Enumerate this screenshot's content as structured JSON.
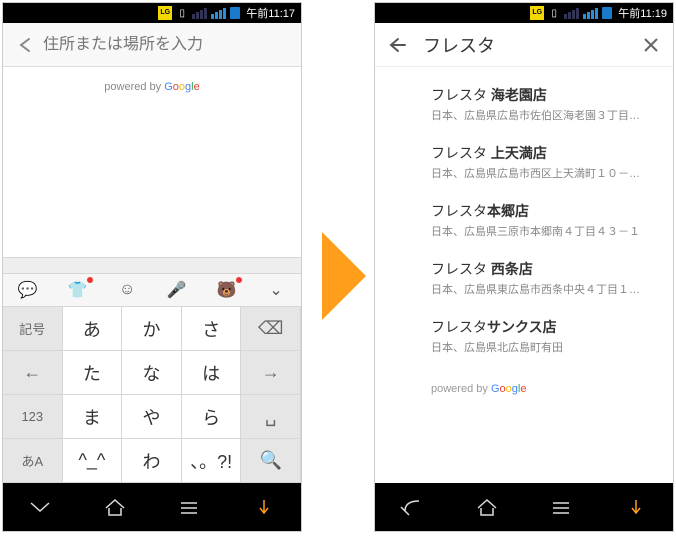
{
  "left": {
    "status_time": "午前11:17",
    "search_placeholder": "住所または場所を入力",
    "powered_prefix": "powered by ",
    "kbd_toolbar": [
      "speech",
      "shirt",
      "emoji",
      "mic",
      "bear",
      "chev"
    ],
    "keys": [
      {
        "t": "記号",
        "cls": "shade"
      },
      {
        "t": "あ"
      },
      {
        "t": "か"
      },
      {
        "t": "さ"
      },
      {
        "t": "⌫",
        "cls": "shade big"
      },
      {
        "t": "←",
        "cls": "shade big"
      },
      {
        "t": "た"
      },
      {
        "t": "な"
      },
      {
        "t": "は"
      },
      {
        "t": "→",
        "cls": "shade big"
      },
      {
        "t": "123",
        "cls": "shade"
      },
      {
        "t": "ま"
      },
      {
        "t": "や"
      },
      {
        "t": "ら"
      },
      {
        "t": "␣",
        "cls": "shade big"
      },
      {
        "t": "あA",
        "cls": "shade k-blue"
      },
      {
        "t": "^_^"
      },
      {
        "t": "わ"
      },
      {
        "t": "、。?!"
      },
      {
        "t": "🔍",
        "cls": "shade big"
      }
    ]
  },
  "right": {
    "status_time": "午前11:19",
    "search_text": "フレスタ",
    "suggestions": [
      {
        "prefix": "フレスタ ",
        "name": "海老園店",
        "addr": "日本、広島県広島市佐伯区海老園３丁目…"
      },
      {
        "prefix": "フレスタ ",
        "name": "上天満店",
        "addr": "日本、広島県広島市西区上天満町１０－…"
      },
      {
        "prefix": "フレスタ",
        "name": "本郷店",
        "addr": "日本、広島県三原市本郷南４丁目４３－１"
      },
      {
        "prefix": "フレスタ ",
        "name": "西条店",
        "addr": "日本、広島県東広島市西条中央４丁目１…"
      },
      {
        "prefix": "フレスタ",
        "name": "サンクス店",
        "addr": "日本、広島県北広島町有田"
      }
    ],
    "powered_prefix": "powered by "
  }
}
